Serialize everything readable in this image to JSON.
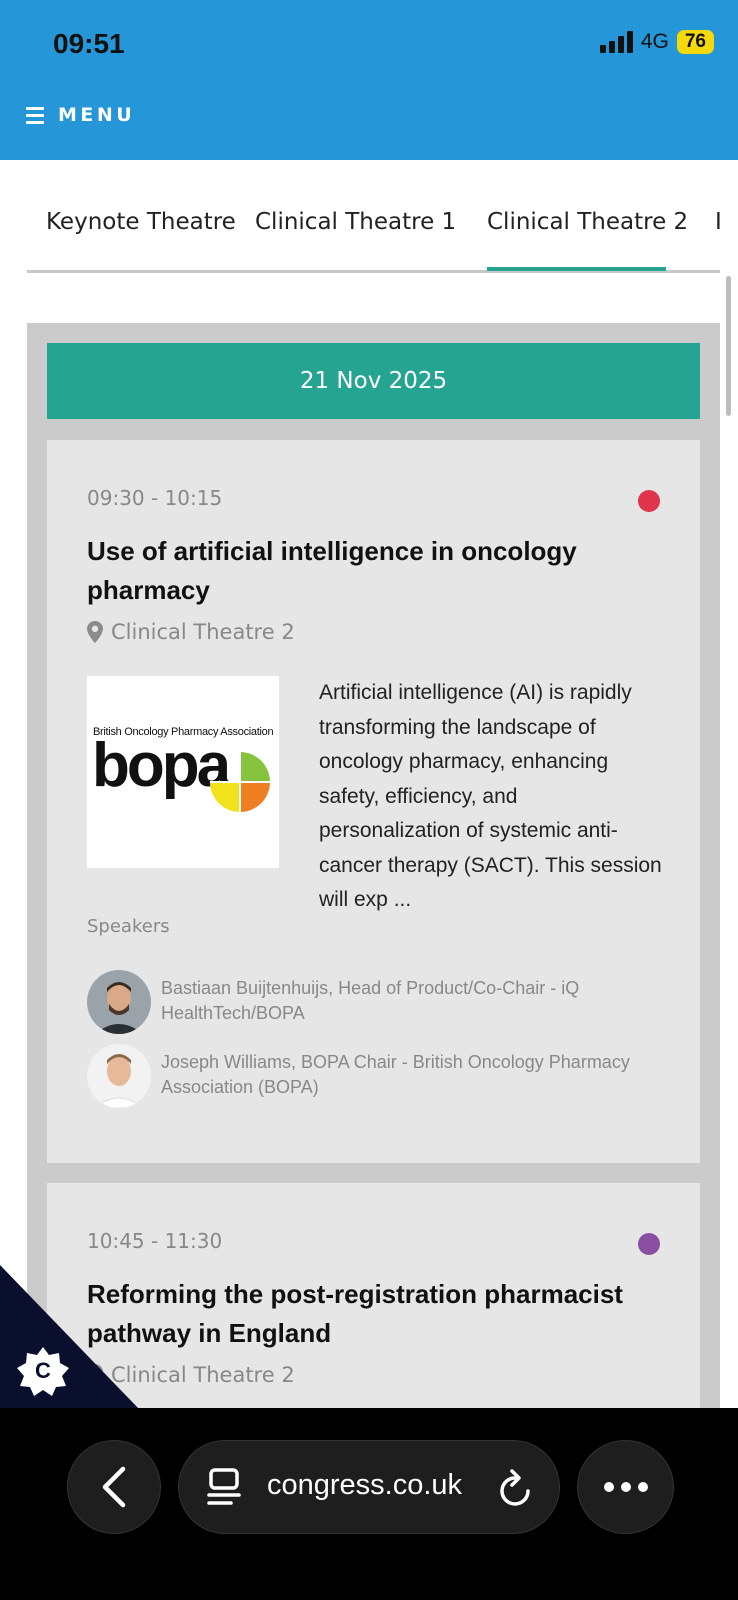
{
  "status_bar": {
    "time": "09:51",
    "network": "4G",
    "battery": "76"
  },
  "header": {
    "menu_label": "MENU"
  },
  "tabs": [
    {
      "label": "Keynote Theatre",
      "active": false
    },
    {
      "label": "Clinical Theatre 1",
      "active": false
    },
    {
      "label": "Clinical Theatre 2",
      "active": true
    },
    {
      "label": "I",
      "active": false
    }
  ],
  "schedule": {
    "date": "21 Nov 2025",
    "sessions": [
      {
        "time": "09:30 - 10:15",
        "dot_color": "#e0334c",
        "title": "Use of artificial intelligence in oncology pharmacy",
        "location": "Clinical Theatre 2",
        "logo": {
          "org_name": "British Oncology Pharmacy Association",
          "wordmark": "bopa"
        },
        "description": "Artificial intelligence (AI) is rapidly transforming the landscape of oncology pharmacy, enhancing safety, efficiency, and personalization of systemic anti-cancer therapy (SACT). This session will exp ...",
        "speakers_label": "Speakers",
        "speakers": [
          {
            "text": "Bastiaan Buijtenhuijs, Head of Product/Co-Chair - iQ HealthTech/BOPA"
          },
          {
            "text": "Joseph Williams, BOPA Chair - British Oncology Pharmacy Association (BOPA)"
          }
        ]
      },
      {
        "time": "10:45 - 11:30",
        "dot_color": "#8a4fa3",
        "title": "Reforming the post-registration pharmacist pathway in England",
        "location": "Clinical Theatre 2"
      }
    ]
  },
  "browser": {
    "url": "congress.co.uk"
  },
  "colors": {
    "header": "#2596d8",
    "accent": "#26a492"
  },
  "icons": [
    "hamburger-icon",
    "location-pin-icon",
    "back-arrow-icon",
    "tabs-icon",
    "reload-icon",
    "more-icon",
    "cookie-badge-icon"
  ]
}
